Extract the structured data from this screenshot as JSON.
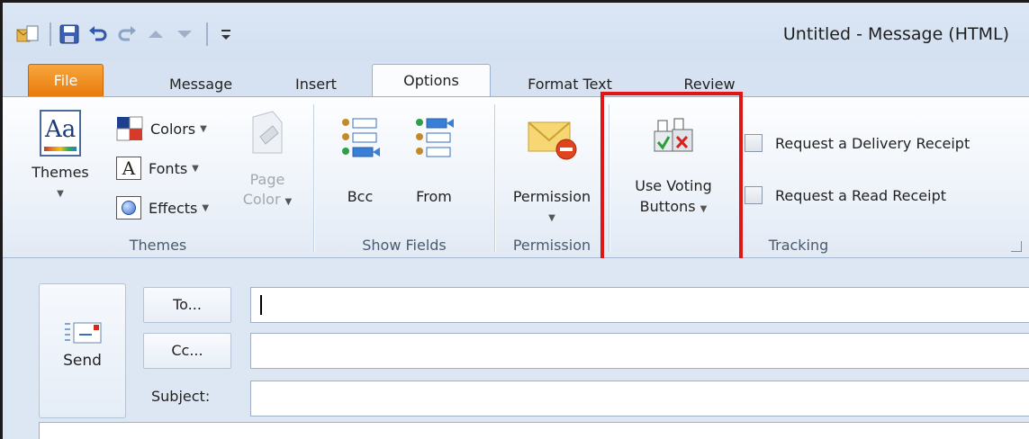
{
  "window": {
    "title": "Untitled  -  Message (HTML)"
  },
  "quick_access": {
    "icons": [
      "outlook-icon",
      "save-icon",
      "undo-icon",
      "redo-icon",
      "up-arrow-icon",
      "down-arrow-icon",
      "customize-icon"
    ]
  },
  "tabs": [
    {
      "label": "File"
    },
    {
      "label": "Message"
    },
    {
      "label": "Insert"
    },
    {
      "label": "Options"
    },
    {
      "label": "Format Text"
    },
    {
      "label": "Review"
    }
  ],
  "ribbon": {
    "themes_group": {
      "label": "Themes",
      "themes_btn": "Themes",
      "colors_btn": "Colors",
      "fonts_btn": "Fonts",
      "effects_btn": "Effects",
      "page_color_line1": "Page",
      "page_color_line2": "Color"
    },
    "show_fields_group": {
      "label": "Show Fields",
      "bcc_btn": "Bcc",
      "from_btn": "From"
    },
    "permission_group": {
      "label": "Permission",
      "permission_btn": "Permission"
    },
    "tracking_group": {
      "label": "Tracking",
      "voting_line1": "Use Voting",
      "voting_line2": "Buttons",
      "delivery_receipt": "Request a Delivery Receipt",
      "read_receipt": "Request a Read Receipt"
    }
  },
  "compose": {
    "send_label": "Send",
    "to_btn": "To...",
    "cc_btn": "Cc...",
    "subject_label": "Subject:",
    "to_value": "",
    "cc_value": "",
    "subject_value": ""
  },
  "highlight_color": "#e01515"
}
